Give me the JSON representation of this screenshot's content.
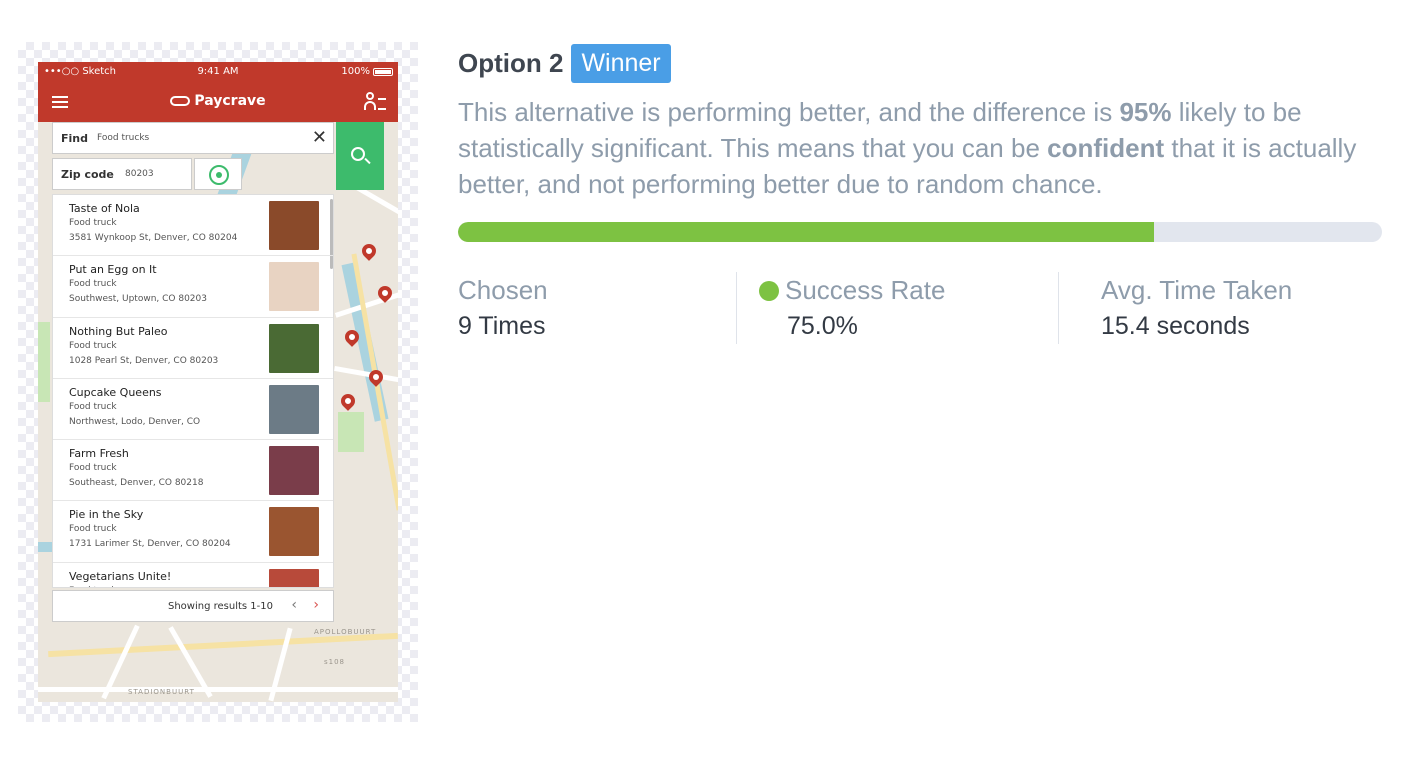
{
  "option": {
    "title": "Option 2",
    "badge": "Winner",
    "description_parts": {
      "p1": "This alternative is performing better, and the difference is ",
      "b1": "95%",
      "p2": " likely to be statistically significant. This means that you can be ",
      "b2": "confident",
      "p3": " that it is actually better, and not performing better due to random chance."
    },
    "progress_fraction": 0.753
  },
  "stats": {
    "chosen": {
      "label": "Chosen",
      "value": "9 Times"
    },
    "success_rate": {
      "label": "Success Rate",
      "value": "75.0%"
    },
    "avg_time": {
      "label": "Avg. Time Taken",
      "value": "15.4 seconds"
    }
  },
  "colors": {
    "badge": "#4a9ee6",
    "progress_fill": "#7dc242",
    "progress_track": "#e2e6ee",
    "app_header": "#c0392b",
    "search_button": "#3dbb6c"
  },
  "mockup": {
    "statusbar": {
      "carrier": "•••○○ Sketch",
      "time": "9:41 AM",
      "battery": "100%"
    },
    "brand": "Paycrave",
    "find": {
      "label": "Find",
      "value": "Food trucks"
    },
    "zip": {
      "label": "Zip code",
      "value": "80203"
    },
    "map_labels": {
      "apollobuurt": "APOLLOBUURT",
      "stadionbuurt": "STADIONBUURT",
      "a108": "s108"
    },
    "results": [
      {
        "name": "Taste of Nola",
        "type": "Food truck",
        "address": "3581 Wynkoop St, Denver, CO 80204",
        "photo": "#8a4a2a"
      },
      {
        "name": "Put an Egg on It",
        "type": "Food truck",
        "address": "Southwest, Uptown, CO 80203",
        "photo": "#e8d3c2"
      },
      {
        "name": "Nothing But Paleo",
        "type": "Food truck",
        "address": "1028 Pearl St, Denver, CO 80203",
        "photo": "#4a6a34"
      },
      {
        "name": "Cupcake Queens",
        "type": "Food truck",
        "address": "Northwest, Lodo, Denver, CO",
        "photo": "#6c7b86"
      },
      {
        "name": "Farm Fresh",
        "type": "Food truck",
        "address": "Southeast, Denver, CO 80218",
        "photo": "#7a3d4a"
      },
      {
        "name": "Pie in the Sky",
        "type": "Food truck",
        "address": "1731 Larimer St, Denver, CO 80204",
        "photo": "#9a5530"
      },
      {
        "name": "Vegetarians Unite!",
        "type": "Food truck",
        "address": "",
        "photo": "#b84a3a"
      }
    ],
    "pager": {
      "text": "Showing results 1-10",
      "prev": "‹",
      "next": "›"
    }
  }
}
